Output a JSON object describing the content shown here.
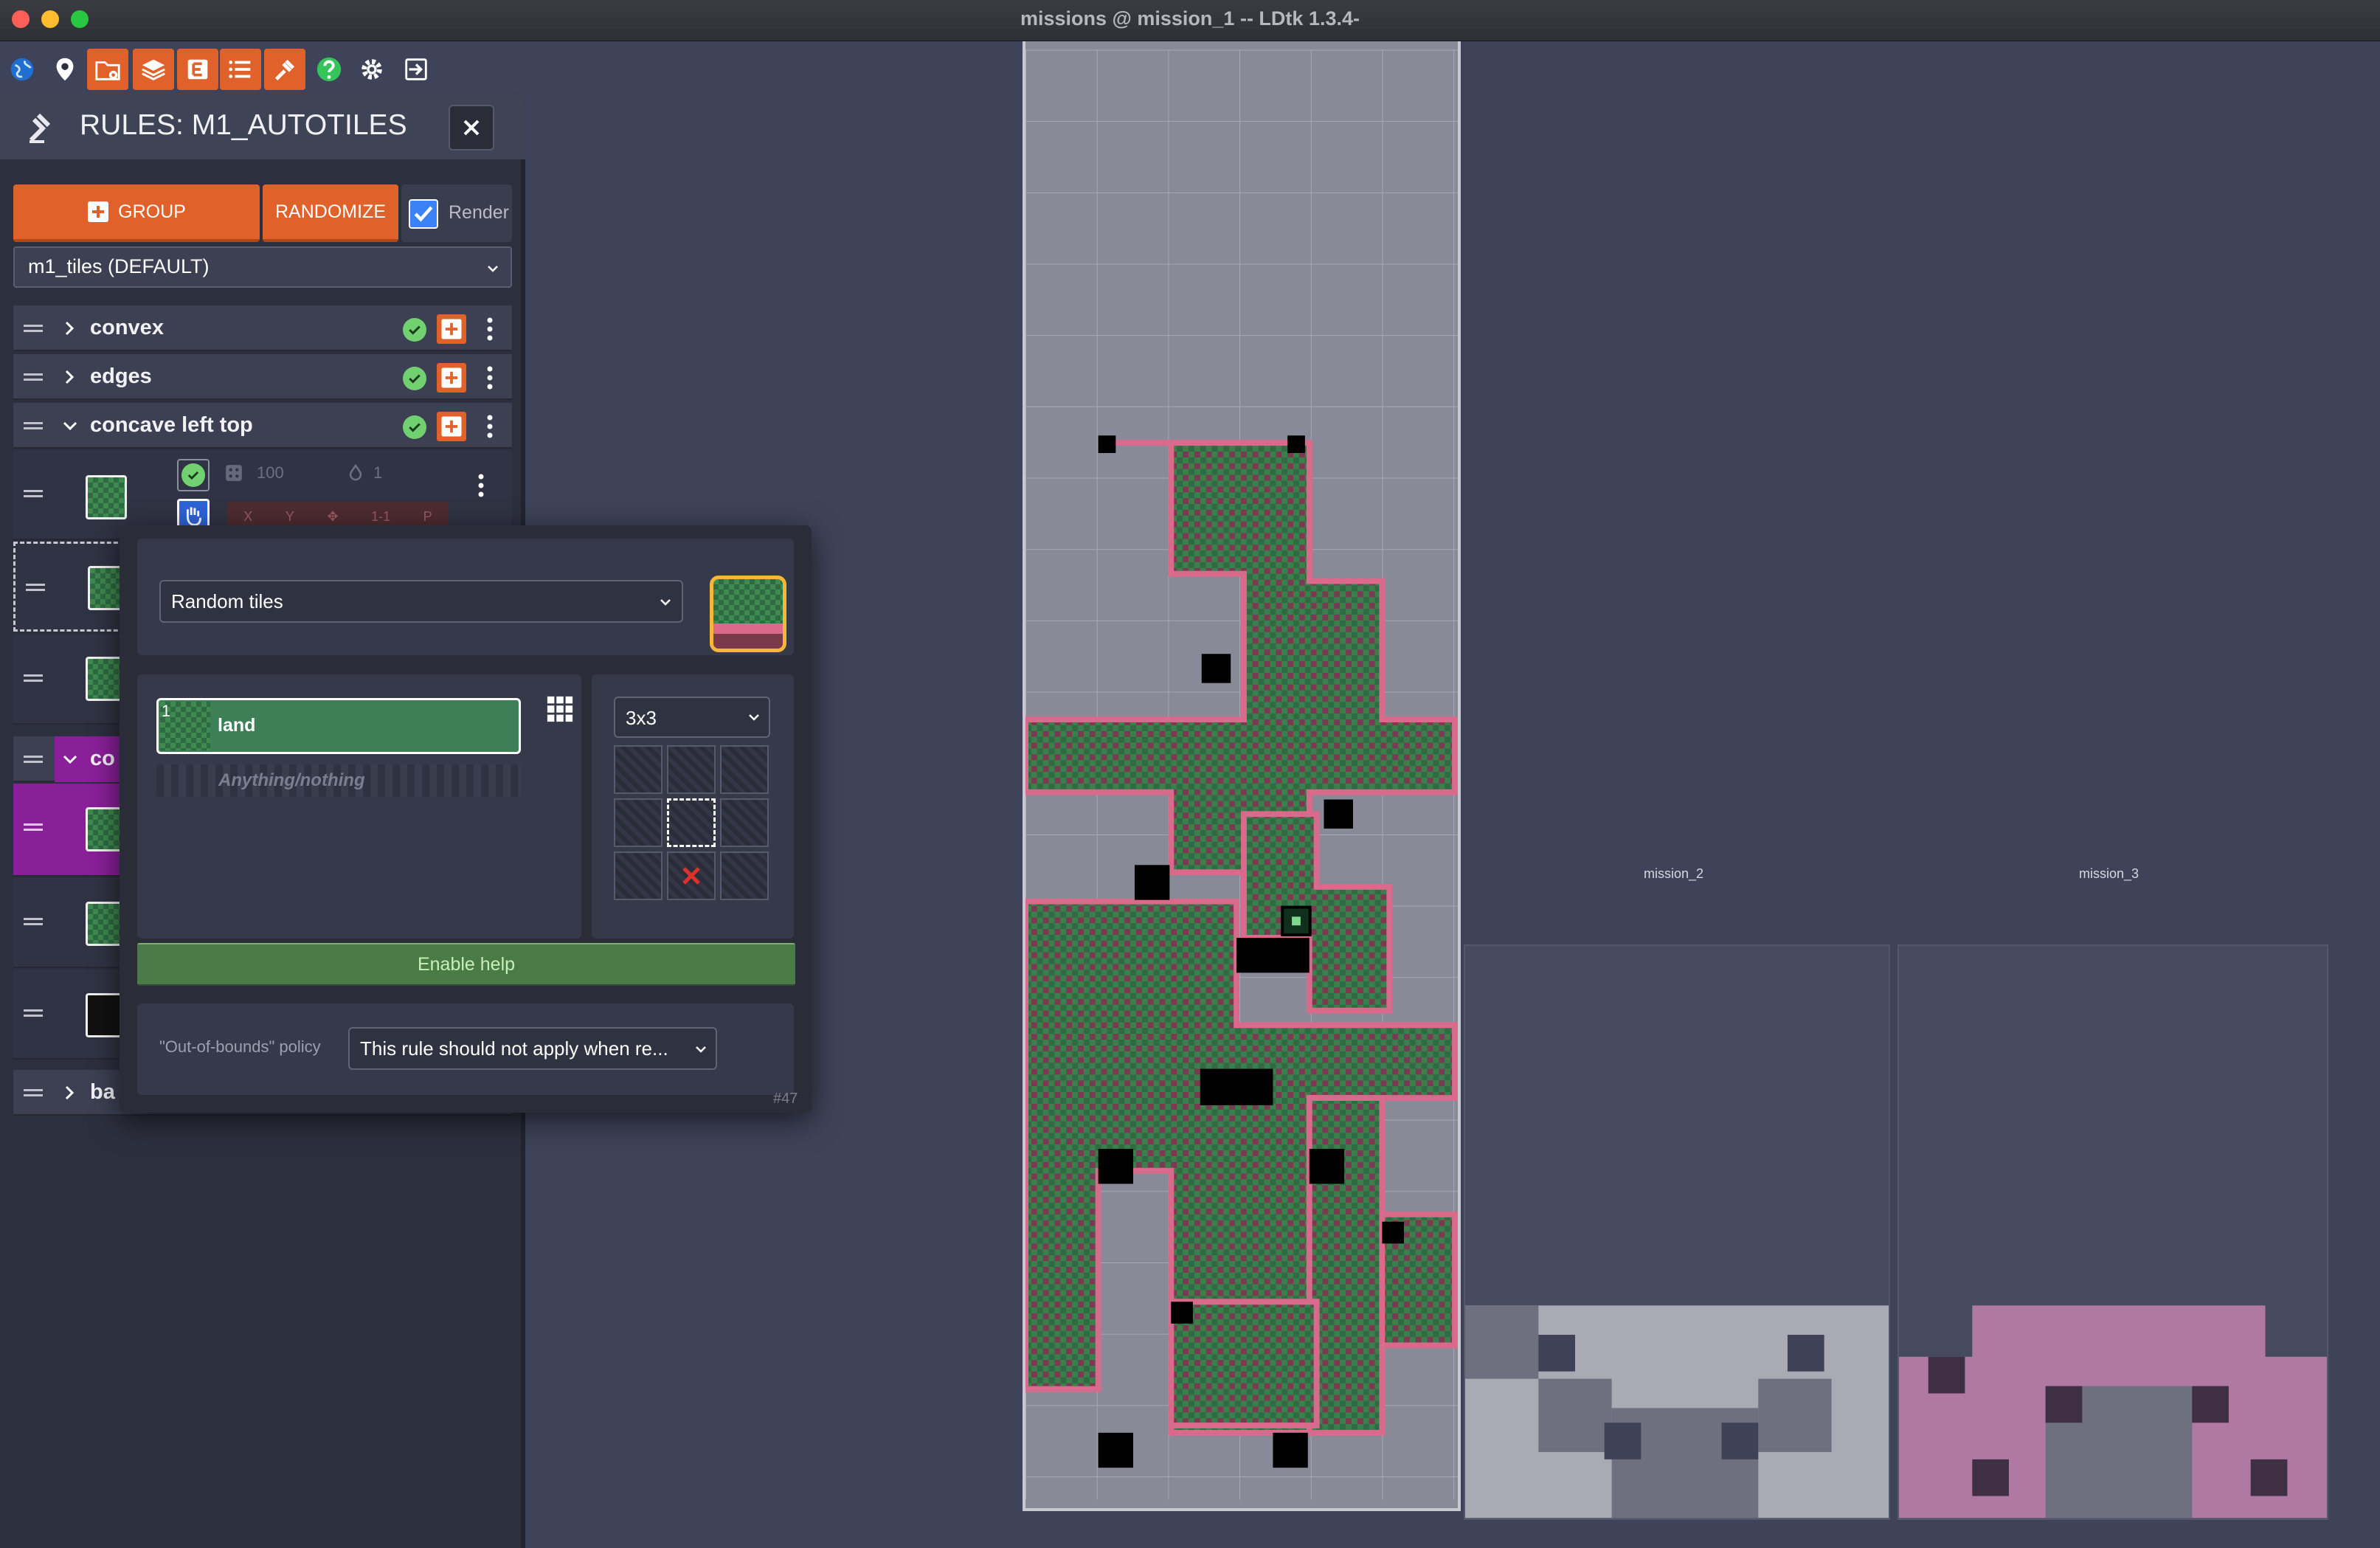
{
  "window": {
    "title": "missions  @ mission_1    --    LDtk 1.3.4-"
  },
  "toolbar": {
    "icons": [
      "world-icon",
      "location-icon",
      "folder-gear-icon",
      "layers-icon",
      "entities-icon",
      "list-icon",
      "rules-brush-icon",
      "help-icon",
      "gear-icon",
      "exit-icon"
    ]
  },
  "panel": {
    "title": "RULES: M1_AUTOTILES",
    "group_button": "GROUP",
    "randomize_button": "RANDOMIZE",
    "render_label": "Render",
    "render_checked": true,
    "group_select": "m1_tiles (DEFAULT)",
    "groups": [
      {
        "name": "convex",
        "expanded": false
      },
      {
        "name": "edges",
        "expanded": false
      },
      {
        "name": "concave left top",
        "expanded": true
      },
      {
        "name": "co",
        "expanded": true,
        "highlight_color": "#8a1f9a"
      },
      {
        "name": "ba",
        "expanded": false
      }
    ],
    "rule": {
      "chance": "100",
      "repeat": "1",
      "x_label": "X",
      "y_label": "Y",
      "offset_label": "1-1",
      "perlin_label": "P"
    }
  },
  "popup": {
    "mode_select": "Random tiles",
    "tag_number": "1",
    "tag_name": "land",
    "anything_label": "Anything/nothing",
    "size_select": "3x3",
    "enable_help": "Enable help",
    "oob_label": "\"Out-of-bounds\" policy",
    "oob_select": "This rule should not apply when re...",
    "rule_id": "#47"
  },
  "levels": {
    "mission_2": "mission_2",
    "mission_3": "mission_3"
  },
  "colors": {
    "accent_orange": "#e0622a",
    "checkbox_blue": "#3b82f6",
    "ok_green": "#71d171",
    "land_green": "#3f8a4f",
    "edge_pink": "#d96a8b",
    "preview_border": "#f6b63a"
  }
}
